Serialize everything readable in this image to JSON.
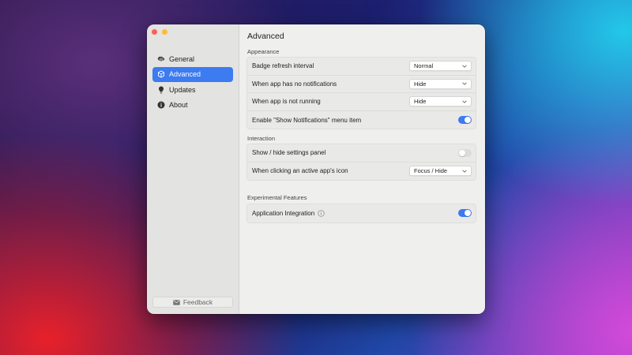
{
  "sidebar": {
    "items": [
      {
        "label": "General",
        "icon": "gear-icon"
      },
      {
        "label": "Advanced",
        "icon": "cube-icon",
        "active": true
      },
      {
        "label": "Updates",
        "icon": "lightbulb-icon"
      },
      {
        "label": "About",
        "icon": "info-icon"
      }
    ],
    "feedback_label": "Feedback"
  },
  "main": {
    "title": "Advanced",
    "sections": [
      {
        "label": "Appearance",
        "rows": [
          {
            "label": "Badge refresh interval",
            "control": "select",
            "value": "Normal"
          },
          {
            "label": "When app has no notifications",
            "control": "select",
            "value": "Hide"
          },
          {
            "label": "When app is not running",
            "control": "select",
            "value": "Hide"
          },
          {
            "label": "Enable \"Show Notifications\" menu item",
            "control": "toggle",
            "on": true
          }
        ]
      },
      {
        "label": "Interaction",
        "rows": [
          {
            "label": "Show / hide settings panel",
            "control": "toggle",
            "on": false
          },
          {
            "label": "When clicking an active app's icon",
            "control": "select",
            "value": "Focus / Hide"
          }
        ]
      },
      {
        "label": "Experimental Features",
        "rows": [
          {
            "label": "Application Integration",
            "control": "toggle",
            "on": true,
            "info_icon": "info-circle-icon"
          }
        ]
      }
    ]
  },
  "colors": {
    "accent": "#3c7bf0",
    "close": "#fe5f57",
    "minimize": "#febc2e"
  }
}
